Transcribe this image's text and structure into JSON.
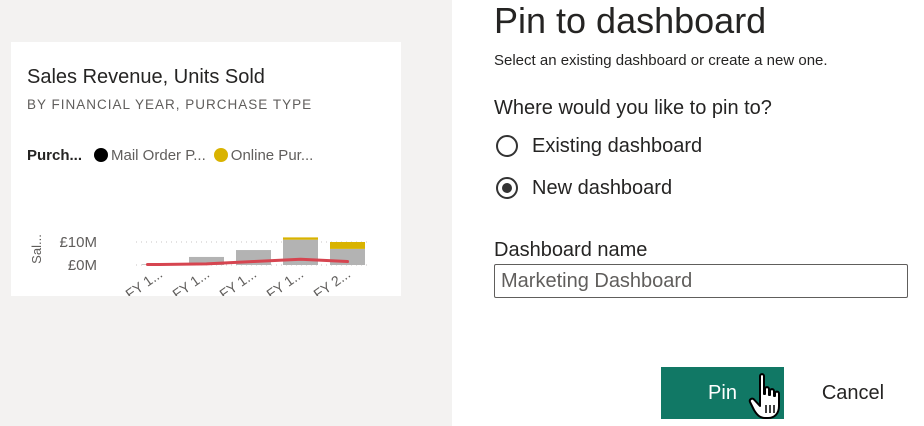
{
  "visual_tile": {
    "title": "Sales Revenue, Units Sold",
    "subtitle": "BY FINANCIAL YEAR, PURCHASE TYPE",
    "legend_title": "Purch...",
    "legend_items": [
      {
        "label": "Mail Order P...",
        "color": "#000000"
      },
      {
        "label": "Online Pur...",
        "color": "#d9b300"
      }
    ]
  },
  "chart_data": {
    "type": "bar",
    "stacked": true,
    "categories": [
      "FY 1...",
      "FY 1...",
      "FY 1...",
      "FY 1...",
      "FY 2..."
    ],
    "series": [
      {
        "name": "Mail Order P...",
        "color": "#b3b3b3",
        "values": [
          0.3,
          3.5,
          6.5,
          11.0,
          7.0
        ]
      },
      {
        "name": "Online Pur...",
        "color": "#d9b300",
        "values": [
          0,
          0,
          0,
          1.0,
          3.0
        ]
      }
    ],
    "line_series": {
      "color": "#d64550",
      "values": [
        0.2,
        0.5,
        1.5,
        2.5,
        1.5
      ]
    },
    "ylabel": "Sal...",
    "y_ticks": [
      "£10M",
      "£0M"
    ],
    "y_tick_values": [
      10,
      0
    ],
    "ylim": [
      0,
      12
    ],
    "grid": true
  },
  "dialog": {
    "title": "Pin to dashboard",
    "subtitle": "Select an existing dashboard or create a new one.",
    "question": "Where would you like to pin to?",
    "options": [
      {
        "label": "Existing dashboard",
        "selected": false
      },
      {
        "label": "New dashboard",
        "selected": true
      }
    ],
    "name_label": "Dashboard name",
    "name_value": "Marketing Dashboard",
    "pin_label": "Pin",
    "cancel_label": "Cancel"
  },
  "colors": {
    "primary_button": "#117865",
    "left_background": "#f3f2f1"
  }
}
